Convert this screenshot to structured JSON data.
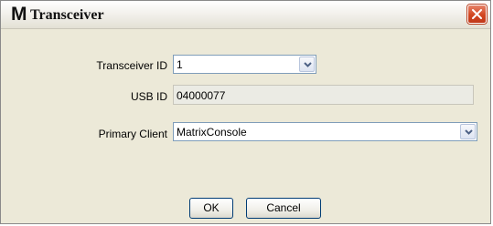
{
  "window": {
    "logo": "M",
    "title": "Transceiver"
  },
  "form": {
    "transceiver_id": {
      "label": "Transceiver ID",
      "value": "1"
    },
    "usb_id": {
      "label": "USB ID",
      "value": "04000077"
    },
    "primary_client": {
      "label": "Primary Client",
      "value": "MatrixConsole"
    }
  },
  "buttons": {
    "ok": "OK",
    "cancel": "Cancel"
  },
  "colors": {
    "close_button": "#d2461f",
    "dialog_background": "#ece9d8",
    "field_border": "#7f9db9"
  }
}
